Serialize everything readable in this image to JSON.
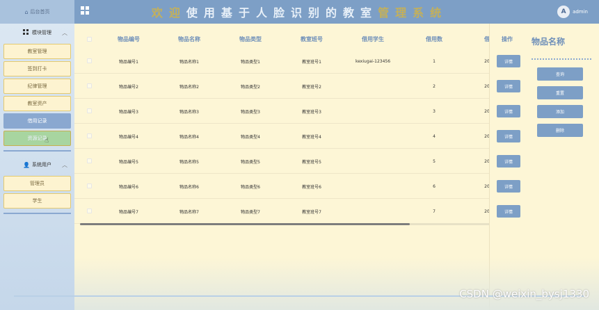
{
  "header": {
    "home_label": "后台首页",
    "title_parts": [
      "欢",
      "迎",
      "使",
      "用",
      "基",
      "于",
      "人",
      "脸",
      "识",
      "别",
      "的",
      "教",
      "室",
      "管",
      "理",
      "系",
      "统"
    ],
    "highlight_indices": [
      0,
      1,
      13,
      14,
      15,
      16
    ],
    "user_name": "admin",
    "avatar_glyph": "A",
    "home_icon": "home-icon",
    "menu_icon": "grid-icon"
  },
  "sidebar": {
    "group1": {
      "label": "模块管理",
      "icon": "grid-icon"
    },
    "group1_items": [
      {
        "label": "教室管理"
      },
      {
        "label": "签到打卡"
      },
      {
        "label": "纪律管理"
      },
      {
        "label": "教室资产"
      },
      {
        "label": "借用记录"
      },
      {
        "label": "资源记录"
      }
    ],
    "group2": {
      "label": "系统用户",
      "icon": "person-icon"
    },
    "group2_items": [
      {
        "label": "管理员"
      },
      {
        "label": "学生"
      }
    ]
  },
  "table": {
    "headers": {
      "item_no": "物品编号",
      "item_name": "物品名称",
      "item_type": "物品类型",
      "class_no": "教室班号",
      "borrower": "借用学生",
      "borrow_count": "借用数",
      "extra": "借",
      "action": "操作"
    },
    "rows": [
      {
        "item_no": "物品编号1",
        "item_name": "物品名称1",
        "item_type": "物品类型1",
        "class_no": "教室班号1",
        "borrower": "kexiugai-123456",
        "count": "1",
        "extra": "20",
        "btn": "详情"
      },
      {
        "item_no": "物品编号2",
        "item_name": "物品名称2",
        "item_type": "物品类型2",
        "class_no": "教室班号2",
        "borrower": "",
        "count": "2",
        "extra": "20",
        "btn": "详情"
      },
      {
        "item_no": "物品编号3",
        "item_name": "物品名称3",
        "item_type": "物品类型3",
        "class_no": "教室班号3",
        "borrower": "",
        "count": "3",
        "extra": "20",
        "btn": "详情"
      },
      {
        "item_no": "物品编号4",
        "item_name": "物品名称4",
        "item_type": "物品类型4",
        "class_no": "教室班号4",
        "borrower": "",
        "count": "4",
        "extra": "20",
        "btn": "详情"
      },
      {
        "item_no": "物品编号5",
        "item_name": "物品名称5",
        "item_type": "物品类型5",
        "class_no": "教室班号5",
        "borrower": "",
        "count": "5",
        "extra": "20",
        "btn": "详情"
      },
      {
        "item_no": "物品编号6",
        "item_name": "物品名称6",
        "item_type": "物品类型6",
        "class_no": "教室班号6",
        "borrower": "",
        "count": "6",
        "extra": "20",
        "btn": "详情"
      },
      {
        "item_no": "物品编号7",
        "item_name": "物品名称7",
        "item_type": "物品类型7",
        "class_no": "教室班号7",
        "borrower": "",
        "count": "7",
        "extra": "20",
        "btn": "详情"
      }
    ]
  },
  "search_panel": {
    "title": "物品名称",
    "buttons": [
      "查询",
      "重置",
      "添加",
      "删除"
    ]
  },
  "watermark": "CSDN @weixin_bysj1330"
}
